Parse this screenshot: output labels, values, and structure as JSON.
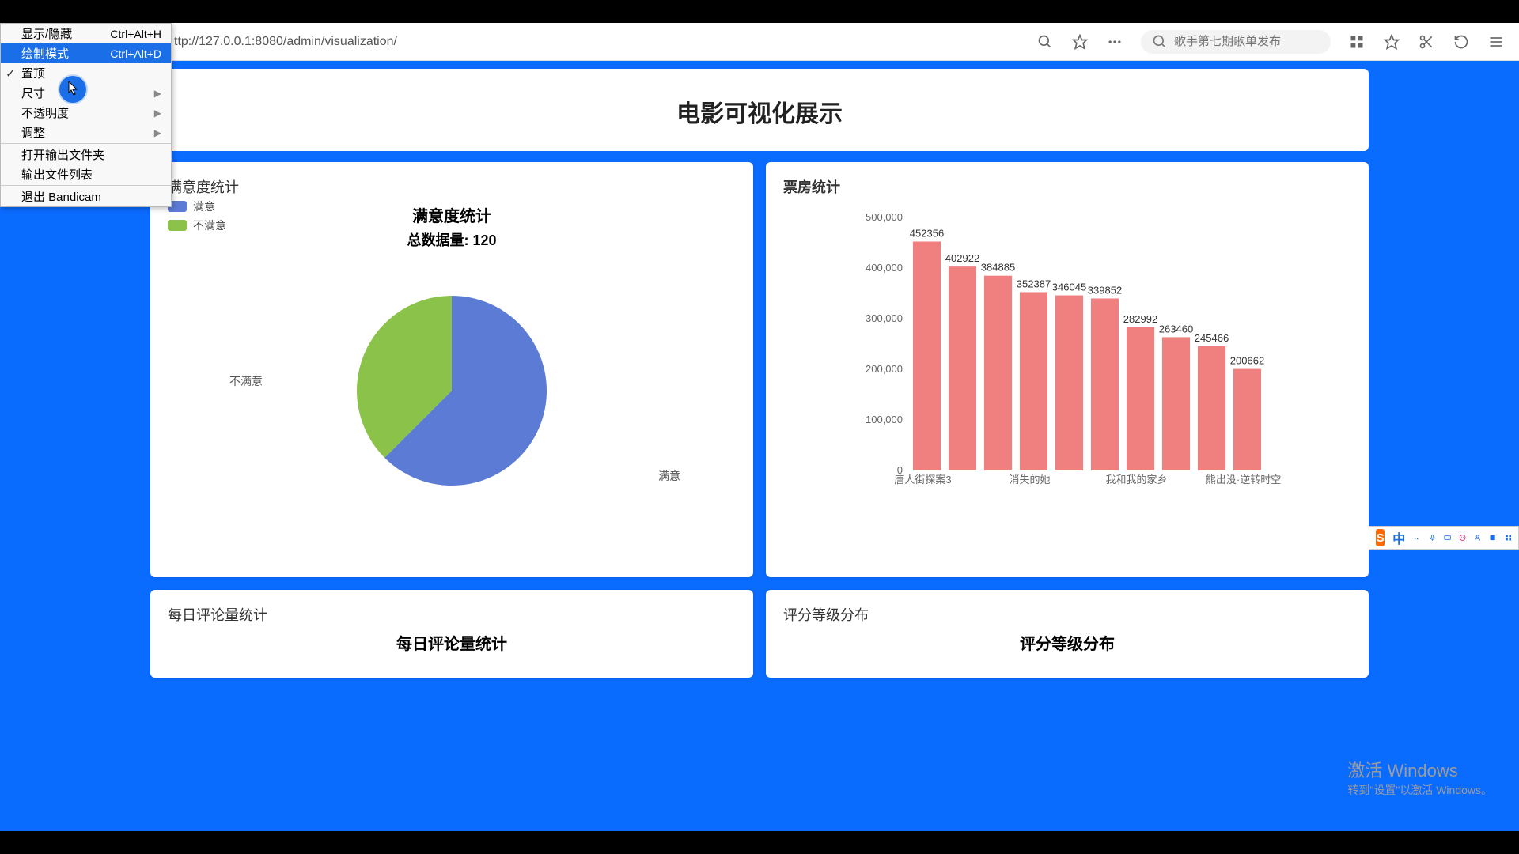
{
  "address_bar": {
    "url": "ttp://127.0.0.1:8080/admin/visualization/",
    "search_placeholder": "歌手第七期歌单发布"
  },
  "context_menu": {
    "items": [
      {
        "label": "显示/隐藏",
        "shortcut": "Ctrl+Alt+H"
      },
      {
        "label": "绘制模式",
        "shortcut": "Ctrl+Alt+D",
        "selected": true
      },
      {
        "label": "置顶",
        "checked": true
      },
      {
        "label": "尺寸",
        "submenu": true
      },
      {
        "label": "不透明度",
        "submenu": true
      },
      {
        "label": "调整",
        "submenu": true
      },
      {
        "sep": true
      },
      {
        "label": "打开输出文件夹"
      },
      {
        "label": "输出文件列表"
      },
      {
        "sep": true
      },
      {
        "label": "退出 Bandicam"
      }
    ]
  },
  "page": {
    "title": "电影可视化展示",
    "pie_card_title": "满意度统计",
    "bar_card_title": "票房统计",
    "pie_chart_title": "满意度统计",
    "pie_chart_sub": "总数据量: 120",
    "daily_card_title": "每日评论量统计",
    "daily_chart_title": "每日评论量统计",
    "rating_card_title": "评分等级分布",
    "rating_chart_title": "评分等级分布"
  },
  "watermark": {
    "line1": "激活 Windows",
    "line2": "转到\"设置\"以激活 Windows。"
  },
  "ime": {
    "logo": "S",
    "lang": "中"
  },
  "chart_data": [
    {
      "type": "pie",
      "title": "满意度统计",
      "subtitle": "总数据量: 120",
      "series": [
        {
          "name": "满意",
          "value": 75,
          "color": "#5b7bd5"
        },
        {
          "name": "不满意",
          "value": 45,
          "color": "#8bc34a"
        }
      ],
      "legend_position": "top-left"
    },
    {
      "type": "bar",
      "title": "票房统计",
      "ylabel": "",
      "ylim": [
        0,
        500000
      ],
      "yticks": [
        0,
        100000,
        200000,
        300000,
        400000,
        500000
      ],
      "categories": [
        "唐人街探案3",
        "",
        "消失的她",
        "",
        "我和我的家乡",
        "",
        "熊出没·逆转时空"
      ],
      "values": [
        452356,
        402922,
        384885,
        352387,
        346045,
        339852,
        282992,
        263460,
        245466,
        200662
      ],
      "color": "#f08080"
    }
  ]
}
